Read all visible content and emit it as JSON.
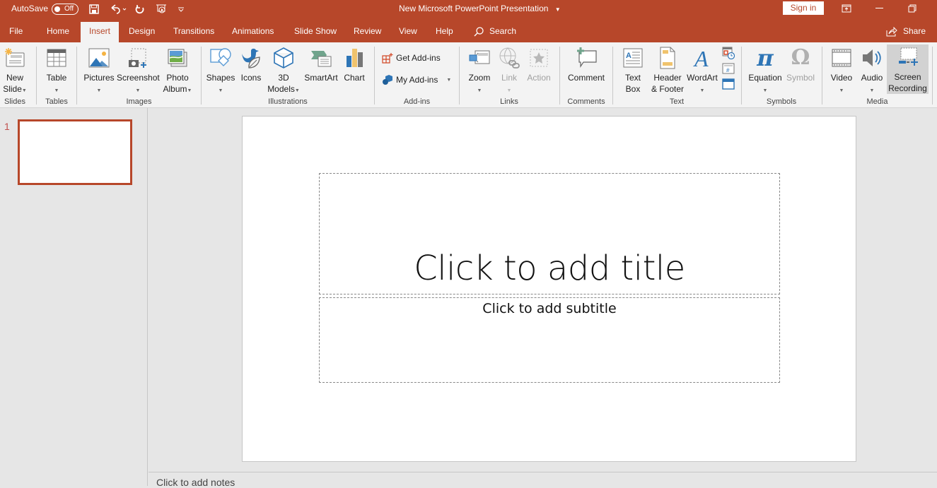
{
  "titlebar": {
    "autosave_label": "AutoSave",
    "autosave_state": "Off",
    "document_title": "New Microsoft PowerPoint Presentation",
    "signin_label": "Sign in",
    "quick_access": [
      "save-icon",
      "undo-icon",
      "redo-icon",
      "start-from-beginning-icon",
      "customize-toolbar-icon"
    ],
    "window_controls": [
      "ribbon-display-options-icon",
      "minimize-icon",
      "restore-icon"
    ]
  },
  "tabs": [
    {
      "label": "File",
      "active": false
    },
    {
      "label": "Home",
      "active": false
    },
    {
      "label": "Insert",
      "active": true
    },
    {
      "label": "Design",
      "active": false
    },
    {
      "label": "Transitions",
      "active": false
    },
    {
      "label": "Animations",
      "active": false
    },
    {
      "label": "Slide Show",
      "active": false
    },
    {
      "label": "Review",
      "active": false
    },
    {
      "label": "View",
      "active": false
    },
    {
      "label": "Help",
      "active": false
    }
  ],
  "search_label": "Search",
  "share_label": "Share",
  "ribbon": {
    "groups": {
      "slides": {
        "label": "Slides",
        "new_slide": [
          "New",
          "Slide"
        ]
      },
      "tables": {
        "label": "Tables",
        "table": "Table"
      },
      "images": {
        "label": "Images",
        "pictures": "Pictures",
        "screenshot": "Screenshot",
        "photo_album": [
          "Photo",
          "Album"
        ]
      },
      "illustrations": {
        "label": "Illustrations",
        "shapes": "Shapes",
        "icons": "Icons",
        "models": [
          "3D",
          "Models"
        ],
        "smartart": "SmartArt",
        "chart": "Chart"
      },
      "addins": {
        "label": "Add-ins",
        "get": "Get Add-ins",
        "my": "My Add-ins"
      },
      "links": {
        "label": "Links",
        "zoom": "Zoom",
        "link": "Link",
        "action": "Action"
      },
      "comments": {
        "label": "Comments",
        "comment": "Comment"
      },
      "text": {
        "label": "Text",
        "textbox": [
          "Text",
          "Box"
        ],
        "header_footer": [
          "Header",
          "& Footer"
        ],
        "wordart": "WordArt"
      },
      "symbols": {
        "label": "Symbols",
        "equation": "Equation",
        "symbol": "Symbol"
      },
      "media": {
        "label": "Media",
        "video": "Video",
        "audio": "Audio",
        "screen_recording": [
          "Screen",
          "Recording"
        ]
      }
    }
  },
  "slides_pane": {
    "slides": [
      {
        "number": "1"
      }
    ]
  },
  "slide": {
    "title_placeholder": "Click to add title",
    "subtitle_placeholder": "Click to add subtitle"
  },
  "notes_placeholder": "Click to add notes",
  "colors": {
    "accent": "#b7472a",
    "ribbon_bg": "#f3f3f3",
    "workspace_bg": "#e6e6e6"
  }
}
